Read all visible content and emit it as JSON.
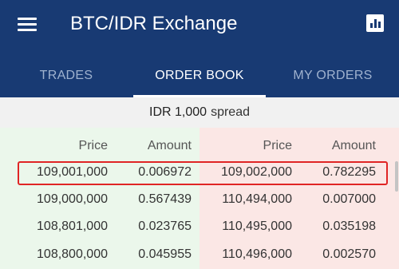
{
  "appbar": {
    "title": "BTC/IDR Exchange",
    "menu_icon": "hamburger-menu-icon",
    "chart_icon": "bar-chart-icon",
    "colors": {
      "background": "#183a73",
      "active": "#ffffff",
      "inactive": "#9fb2cf"
    }
  },
  "tabs": [
    {
      "label": "TRADES",
      "active": false
    },
    {
      "label": "ORDER BOOK",
      "active": true
    },
    {
      "label": "MY ORDERS",
      "active": false
    }
  ],
  "spread": {
    "value": "IDR 1,000",
    "label": "spread"
  },
  "headers": {
    "bid_price": "Price",
    "bid_amount": "Amount",
    "ask_price": "Price",
    "ask_amount": "Amount"
  },
  "rows": [
    {
      "bid_price": "109,001,000",
      "bid_amount": "0.006972",
      "ask_price": "109,002,000",
      "ask_amount": "0.782295",
      "highlighted": true
    },
    {
      "bid_price": "109,000,000",
      "bid_amount": "0.567439",
      "ask_price": "110,494,000",
      "ask_amount": "0.007000"
    },
    {
      "bid_price": "108,801,000",
      "bid_amount": "0.023765",
      "ask_price": "110,495,000",
      "ask_amount": "0.035198"
    },
    {
      "bid_price": "108,800,000",
      "bid_amount": "0.045955",
      "ask_price": "110,496,000",
      "ask_amount": "0.002570"
    }
  ],
  "colors": {
    "bid_bg": "#ebf7eb",
    "ask_bg": "#fbe7e5",
    "highlight_border": "#e02525"
  }
}
